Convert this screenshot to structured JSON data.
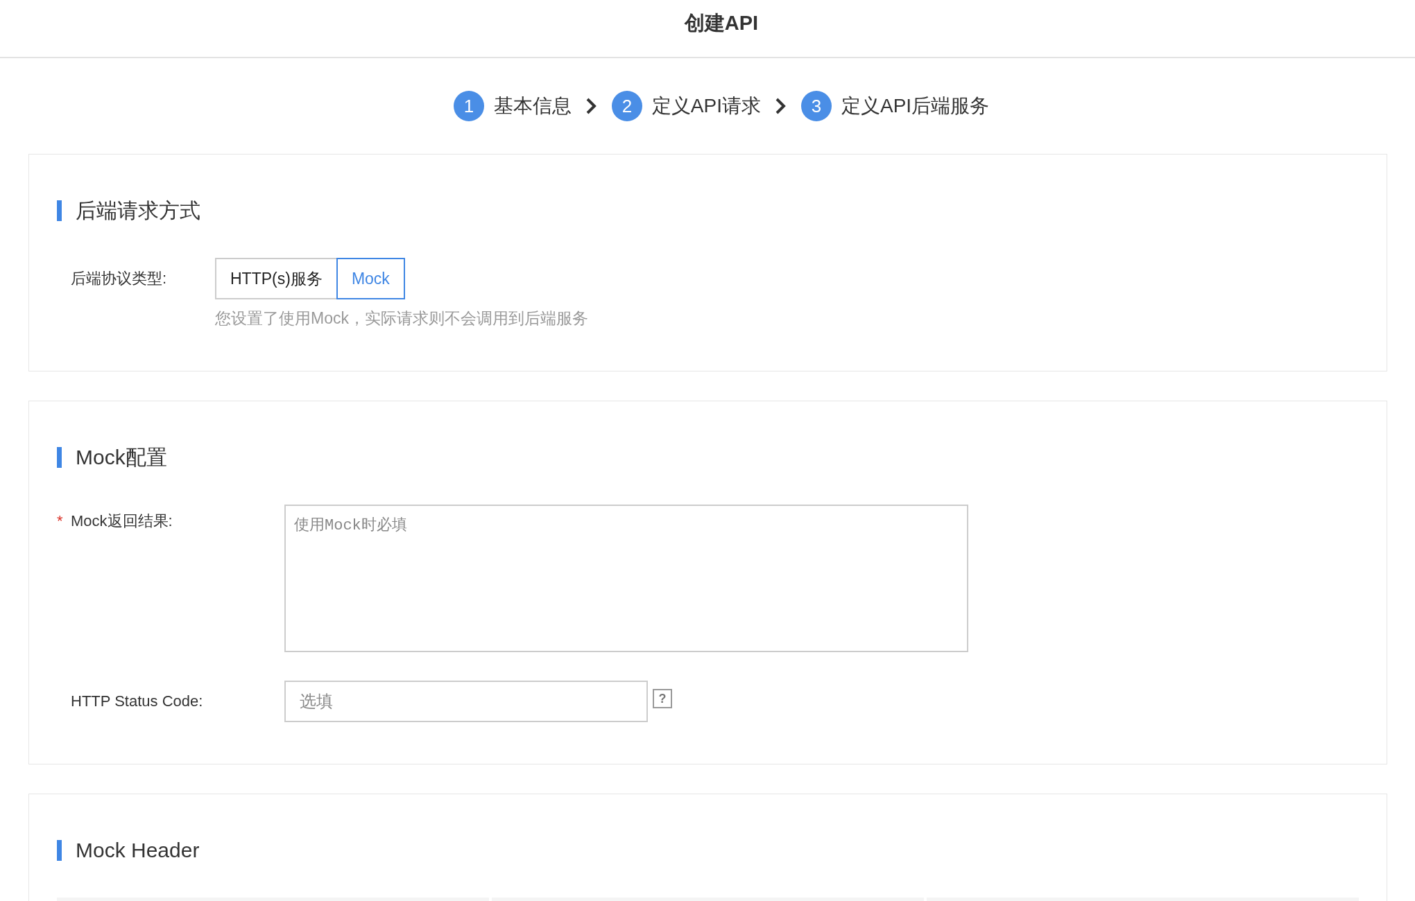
{
  "header": {
    "title": "创建API"
  },
  "steps": [
    {
      "number": "1",
      "label": "基本信息"
    },
    {
      "number": "2",
      "label": "定义API请求"
    },
    {
      "number": "3",
      "label": "定义API后端服务"
    }
  ],
  "sections": [
    {
      "kind": "protocol",
      "title": "后端请求方式",
      "label": "后端协议类型:",
      "options": [
        {
          "label": "HTTP(s)服务",
          "selected": false
        },
        {
          "label": "Mock",
          "selected": true
        }
      ],
      "hint": "您设置了使用Mock，实际请求则不会调用到后端服务"
    },
    {
      "kind": "form",
      "title": "Mock配置",
      "fields": [
        {
          "kind": "textarea",
          "marker": "*",
          "label": "Mock返回结果:",
          "placeholder": "使用Mock时必填"
        },
        {
          "kind": "input",
          "label": "HTTP Status Code:",
          "placeholder": "选填",
          "help": "?"
        }
      ]
    },
    {
      "kind": "table",
      "title": "Mock Header"
    }
  ]
}
